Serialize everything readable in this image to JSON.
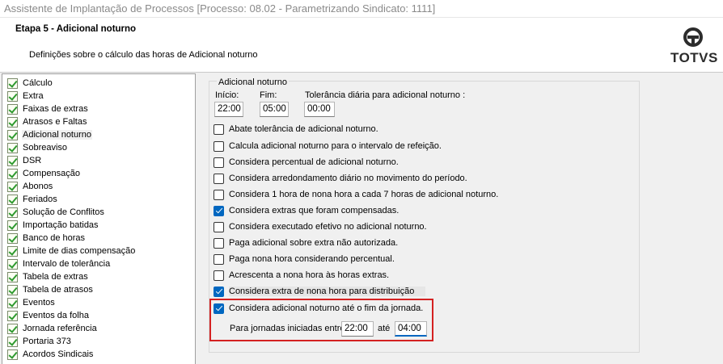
{
  "window": {
    "title": "Assistente de Implantação de Processos [Processo: 08.02 - Parametrizando Sindicato: 1111]"
  },
  "header": {
    "step_title": "Etapa 5 - Adicional noturno",
    "step_description": "Definições sobre o cálculo das horas de Adicional noturno",
    "logo_text": "TOTVS"
  },
  "sidebar": {
    "items": [
      {
        "label": "Cálculo"
      },
      {
        "label": "Extra"
      },
      {
        "label": "Faixas de extras"
      },
      {
        "label": "Atrasos e Faltas"
      },
      {
        "label": "Adicional noturno"
      },
      {
        "label": "Sobreaviso"
      },
      {
        "label": "DSR"
      },
      {
        "label": "Compensação"
      },
      {
        "label": "Abonos"
      },
      {
        "label": "Feriados"
      },
      {
        "label": "Solução de Conflitos"
      },
      {
        "label": "Importação batidas"
      },
      {
        "label": "Banco de horas"
      },
      {
        "label": "Limite de dias compensação"
      },
      {
        "label": "Intervalo de tolerância"
      },
      {
        "label": "Tabela de extras"
      },
      {
        "label": "Tabela de atrasos"
      },
      {
        "label": "Eventos"
      },
      {
        "label": "Eventos da folha"
      },
      {
        "label": "Jornada referência"
      },
      {
        "label": "Portaria 373"
      },
      {
        "label": "Acordos Sindicais"
      }
    ],
    "selected": "Adicional noturno"
  },
  "group": {
    "title": "Adicional noturno",
    "inicio_label": "Início:",
    "inicio_value": "22:00",
    "fim_label": "Fim:",
    "fim_value": "05:00",
    "tolerancia_label": "Tolerância diária para adicional noturno :",
    "tolerancia_value": "00:00"
  },
  "options": [
    {
      "label": "Abate tolerância de adicional noturno.",
      "checked": false
    },
    {
      "label": "Calcula adicional noturno para o intervalo de refeição.",
      "checked": false
    },
    {
      "label": "Considera percentual de adicional noturno.",
      "checked": false
    },
    {
      "label": "Considera arredondamento diário no movimento do período.",
      "checked": false
    },
    {
      "label": "Considera 1 hora de nona hora  a cada 7 horas de adicional noturno.",
      "checked": false
    },
    {
      "label": "Considera extras que foram compensadas.",
      "checked": true
    },
    {
      "label": "Considera executado efetivo no adicional noturno.",
      "checked": false
    },
    {
      "label": "Paga adicional sobre extra não autorizada.",
      "checked": false
    },
    {
      "label": "Paga nona hora considerando percentual.",
      "checked": false
    },
    {
      "label": "Acrescenta a nona hora às horas extras.",
      "checked": false
    },
    {
      "label": "Considera extra de nona hora para distribuição",
      "checked": true
    },
    {
      "label": "Considera adicional noturno até o fim da jornada.",
      "checked": true
    }
  ],
  "jornada": {
    "label": "Para jornadas iniciadas entre",
    "start_value": "22:00",
    "ate_label": "até",
    "end_value": "04:00"
  },
  "colors": {
    "checkbox_checked": "#0067c0",
    "highlight_border": "#d42121"
  }
}
